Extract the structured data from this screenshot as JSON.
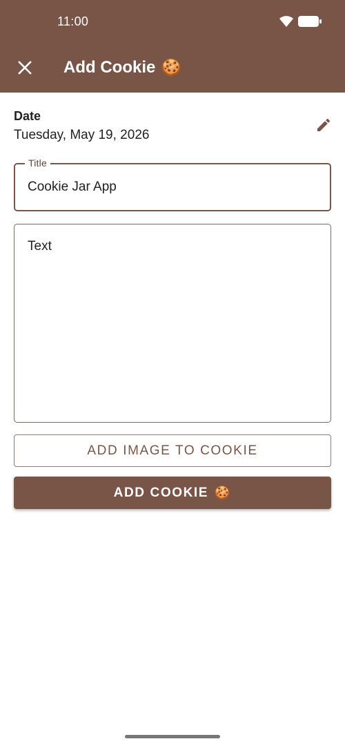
{
  "status_bar": {
    "time": "11:00",
    "icons": [
      "wifi-icon",
      "battery-icon"
    ]
  },
  "app_bar": {
    "close_icon": "close-icon",
    "title": "Add Cookie",
    "title_emoji": "🍪"
  },
  "date_section": {
    "label": "Date",
    "value": "Tuesday, May 19, 2026",
    "edit_icon": "pencil-icon"
  },
  "title_field": {
    "label": "Title",
    "value": "Cookie Jar App"
  },
  "text_field": {
    "placeholder": "Text"
  },
  "buttons": {
    "add_image": "ADD IMAGE TO COOKIE",
    "add_cookie": "ADD COOKIE",
    "add_cookie_emoji": "🍪"
  },
  "colors": {
    "primary": "#795548",
    "on_primary": "#ffffff",
    "text": "#212121"
  }
}
